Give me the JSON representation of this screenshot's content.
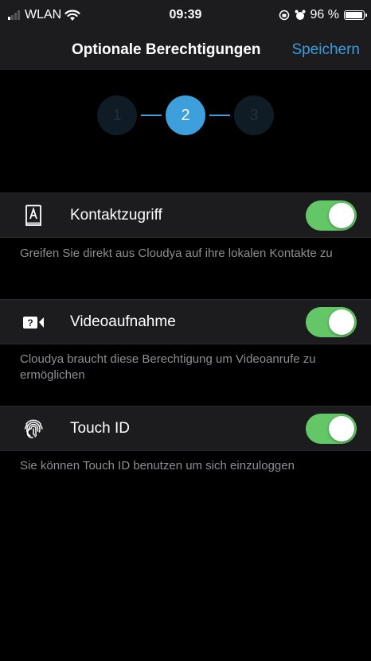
{
  "status_bar": {
    "carrier": "WLAN",
    "time": "09:39",
    "battery_percent": "96 %",
    "battery_level": 0.96
  },
  "nav": {
    "title": "Optionale Berechtigungen",
    "save_label": "Speichern"
  },
  "stepper": {
    "steps": [
      "1",
      "2",
      "3"
    ],
    "active_step": "2"
  },
  "permissions": [
    {
      "label": "Kontaktzugriff",
      "icon": "contact-book-icon",
      "enabled": true,
      "description": "Greifen Sie direkt aus Cloudya auf ihre lokalen Kontakte zu"
    },
    {
      "label": "Videoaufnahme",
      "icon": "video-camera-icon",
      "enabled": true,
      "description": "Cloudya braucht diese Berechtigung um Videoanrufe zu ermöglichen"
    },
    {
      "label": "Touch ID",
      "icon": "fingerprint-icon",
      "enabled": true,
      "description": "Sie können Touch ID benutzen um sich einzuloggen"
    }
  ],
  "colors": {
    "accent": "#3a9be0",
    "toggle_on": "#63c768",
    "background": "#000000",
    "row_background": "#1c1c1e"
  }
}
